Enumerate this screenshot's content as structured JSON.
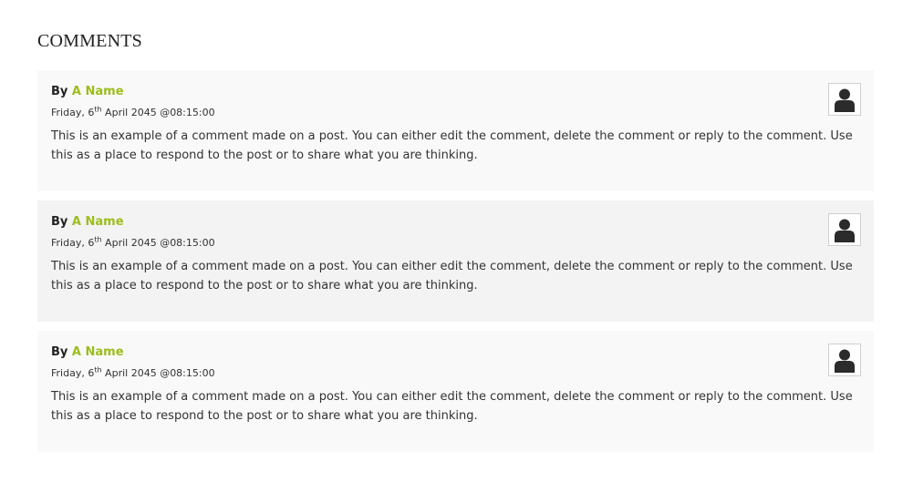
{
  "section": {
    "title": "COMMENTS"
  },
  "comments": [
    {
      "by_label": "By",
      "author": "A Name",
      "date_prefix": "Friday, 6",
      "date_sup": "th",
      "date_suffix": " April 2045 @08:15:00",
      "body": "This is an example of a comment made on a post. You can either edit the comment, delete the comment or reply to the comment. Use this as a place to respond to the post or to share what you are thinking.",
      "avatar_icon": "user-silhouette-icon"
    },
    {
      "by_label": "By",
      "author": "A Name",
      "date_prefix": "Friday, 6",
      "date_sup": "th",
      "date_suffix": " April 2045 @08:15:00",
      "body": "This is an example of a comment made on a post. You can either edit the comment, delete the comment or reply to the comment. Use this as a place to respond to the post or to share what you are thinking.",
      "avatar_icon": "user-silhouette-icon"
    },
    {
      "by_label": "By",
      "author": "A Name",
      "date_prefix": "Friday, 6",
      "date_sup": "th",
      "date_suffix": " April 2045 @08:15:00",
      "body": "This is an example of a comment made on a post. You can either edit the comment, delete the comment or reply to the comment. Use this as a place to respond to the post or to share what you are thinking.",
      "avatar_icon": "user-silhouette-icon"
    }
  ],
  "colors": {
    "author_accent": "#9bbd1c",
    "card_light": "#f9f9f9",
    "card_dark": "#f3f3f3",
    "avatar_fill": "#2b2b2b"
  }
}
